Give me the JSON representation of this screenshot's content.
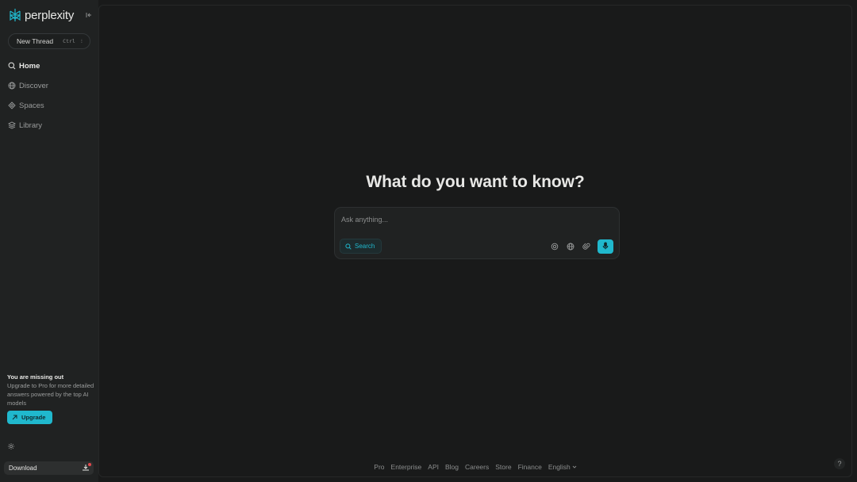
{
  "brand": {
    "name": "perplexity",
    "logo_icon": "perplexity-logo-icon"
  },
  "sidebar": {
    "collapse_icon": "collapse-sidebar-icon",
    "new_thread": {
      "label": "New Thread",
      "shortcut_modifier": "Ctrl",
      "shortcut_key": "⁝"
    },
    "items": [
      {
        "label": "Home",
        "icon": "home-search-icon",
        "active": true
      },
      {
        "label": "Discover",
        "icon": "globe-icon",
        "active": false
      },
      {
        "label": "Spaces",
        "icon": "spaces-icon",
        "active": false
      },
      {
        "label": "Library",
        "icon": "library-icon",
        "active": false
      }
    ],
    "promo": {
      "title": "You are missing out",
      "text": "Upgrade to Pro for more detailed answers powered by the top AI models",
      "button_label": "Upgrade"
    },
    "settings_icon": "gear-icon",
    "download": {
      "label": "Download",
      "icon": "download-icon"
    }
  },
  "main": {
    "headline": "What do you want to know?",
    "search": {
      "placeholder": "Ask anything...",
      "mode_label": "Search",
      "tools": [
        "focus-icon",
        "globe-icon",
        "attach-icon"
      ],
      "mic_icon": "microphone-icon"
    },
    "footer": {
      "links": [
        "Pro",
        "Enterprise",
        "API",
        "Blog",
        "Careers",
        "Store",
        "Finance"
      ],
      "language": "English"
    },
    "help_label": "?"
  },
  "colors": {
    "accent": "#20b8cd",
    "background": "#191a1a",
    "sidebar": "#202222"
  }
}
